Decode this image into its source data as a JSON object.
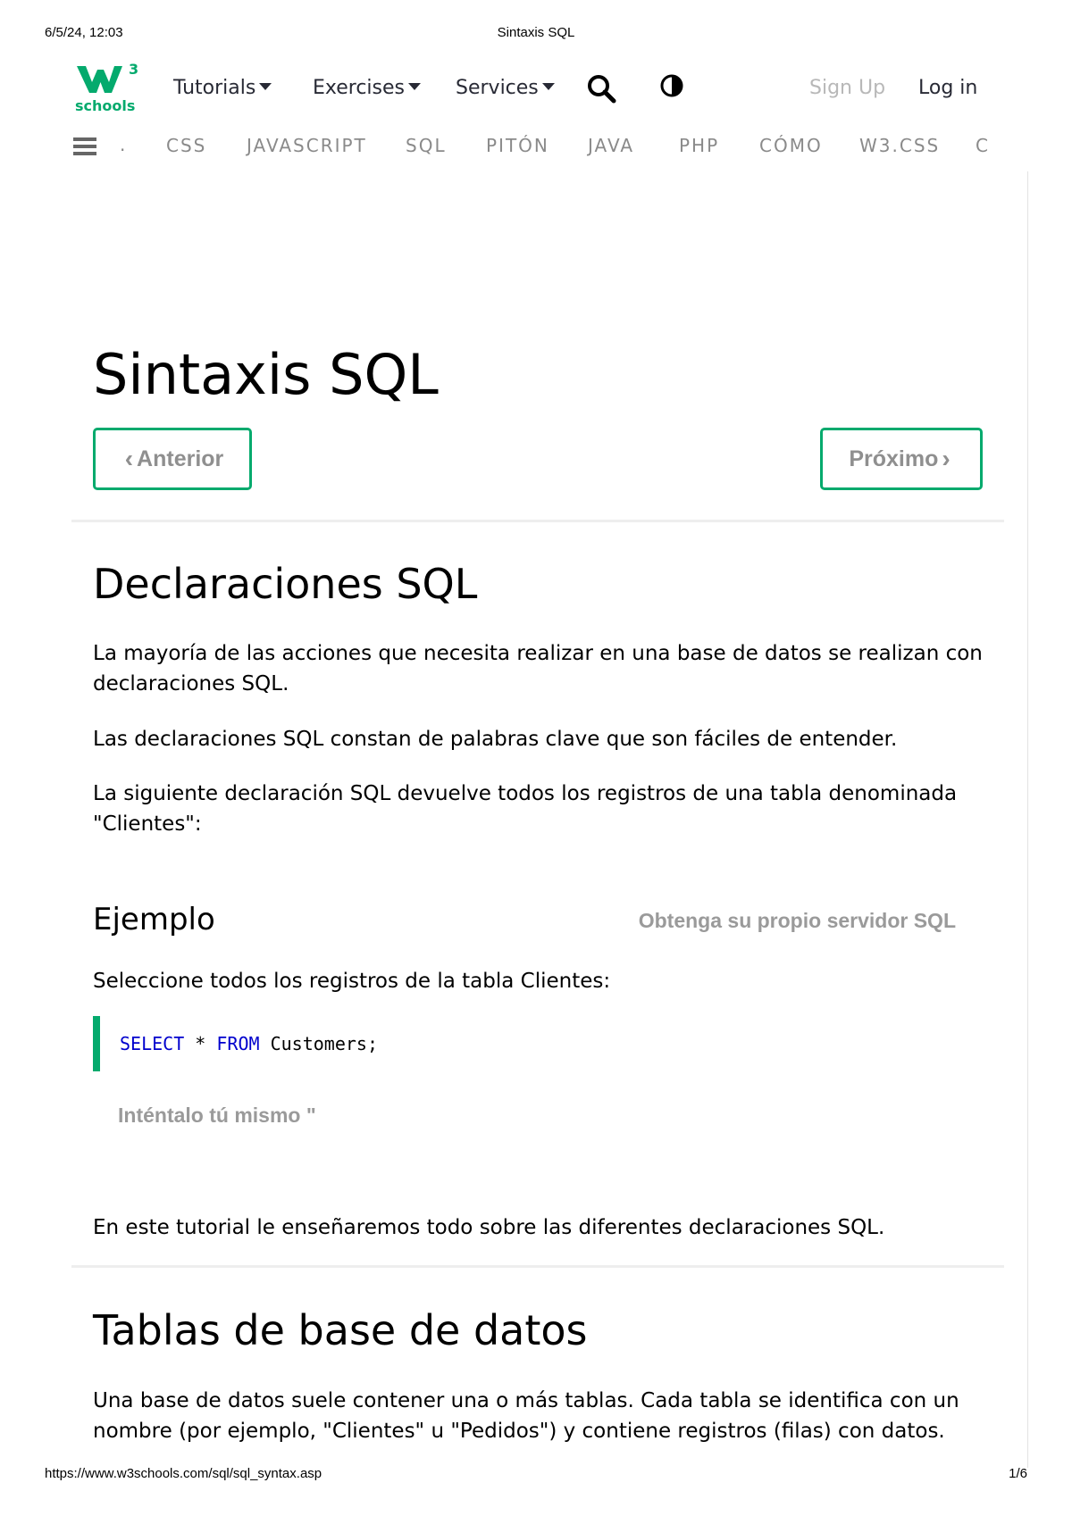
{
  "print": {
    "date": "6/5/24, 12:03",
    "title": "Sintaxis SQL",
    "url": "https://www.w3schools.com/sql/sql_syntax.asp",
    "page": "1/6"
  },
  "topnav": {
    "logo_sup": "3",
    "logo_text": "schools",
    "tutorials": "Tutorials",
    "exercises": "Exercises",
    "services": "Services",
    "signup": "Sign Up",
    "login": "Log in"
  },
  "subnav": {
    "dot": ".",
    "items": [
      "CSS",
      "JAVASCRIPT",
      "SQL",
      "PITÓN",
      "JAVA",
      "PHP",
      "CÓMO",
      "W3.CSS",
      "C"
    ]
  },
  "page": {
    "title": "Sintaxis SQL",
    "prev": "Anterior",
    "next": "Próximo"
  },
  "section1": {
    "heading": "Declaraciones SQL",
    "p1": "La mayoría de las acciones que necesita realizar en una base de datos se realizan con declaraciones SQL.",
    "p2": "Las declaraciones SQL constan de palabras clave que son fáciles de entender.",
    "p3": "La siguiente declaración SQL devuelve todos los registros de una tabla denominada \"Clientes\":"
  },
  "example": {
    "heading": "Ejemplo",
    "server_link": "Obtenga su propio servidor SQL",
    "desc": "Seleccione todos los registros de la tabla Clientes:",
    "code_kw1": "SELECT",
    "code_mid": " * ",
    "code_kw2": "FROM",
    "code_end": " Customers;",
    "try_it": "Inténtalo tú mismo \""
  },
  "tutorial_text": "En este tutorial le enseñaremos todo sobre las diferentes declaraciones SQL.",
  "section2": {
    "heading": "Tablas de base de datos",
    "p1": "Una base de datos suele contener una o más tablas. Cada tabla se identifica con un nombre (por ejemplo, \"Clientes\" u \"Pedidos\") y contiene registros (filas) con datos."
  },
  "colors": {
    "accent": "#04aa6d",
    "keyword": "#0000cd",
    "muted": "#9a9a9a"
  }
}
